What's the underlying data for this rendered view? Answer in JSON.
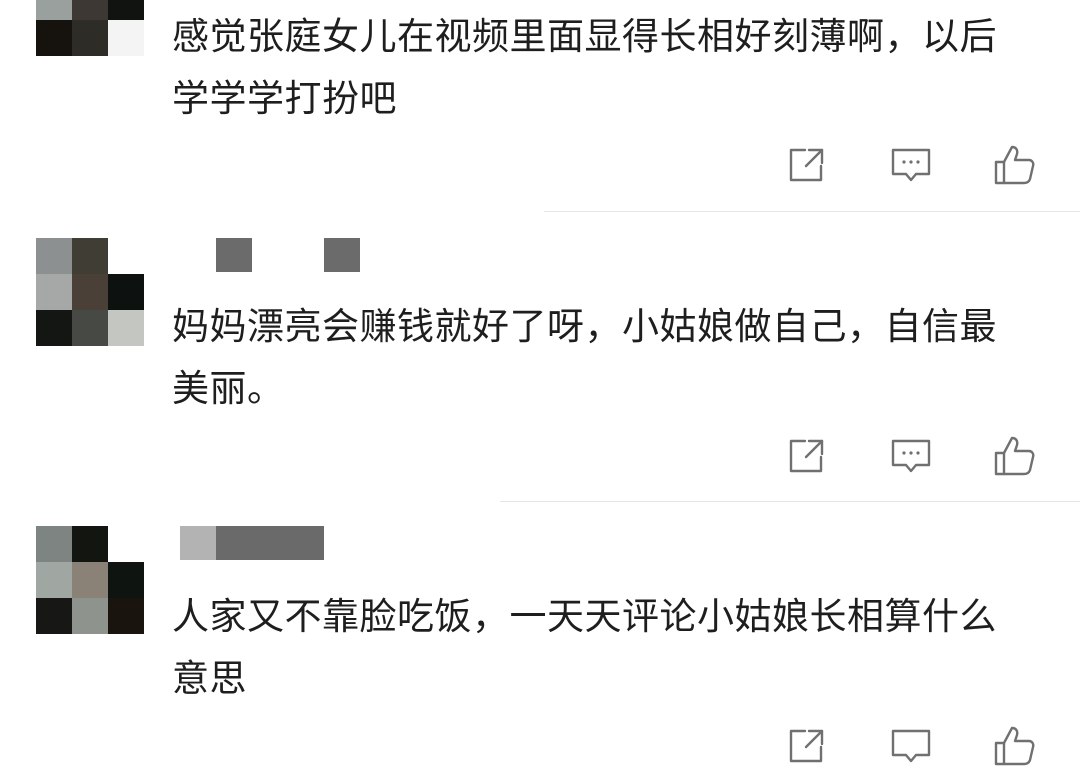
{
  "comments": [
    {
      "text": "感觉张庭女儿在视频里面显得长相好刻薄啊，以后学学学打扮吧",
      "avatar_colors": [
        "#8e9394",
        "#4d4137",
        "#1e1f1c",
        "#16130f",
        "#2d2c27",
        "#f4f4f4"
      ]
    },
    {
      "text": "妈妈漂亮会赚钱就好了呀，小姑娘做自己，自信最美丽。",
      "avatar_colors": [
        "#8c9091",
        "#3f3d34",
        "#ffffff",
        "#a5a8a7",
        "#4a4038",
        "#0d1110",
        "#131612",
        "#474a44",
        "#c4c6c1"
      ],
      "name_block_colors": [
        "#6b6b6b",
        "#6b6b6b"
      ]
    },
    {
      "text": "人家又不靠脸吃饭，一天天评论小姑娘长相算什么意思",
      "avatar_colors": [
        "#7e8481",
        "#121510",
        "#ffffff",
        "#a0a6a2",
        "#8a8276",
        "#0e1410",
        "#171815",
        "#8f938d",
        "#1a140e"
      ],
      "name_block_colors": [
        "#b3b3b3",
        "#6a6a6a"
      ]
    }
  ],
  "actions": {
    "share_icon": "share-icon",
    "reply_icon": "reply-icon",
    "like_icon": "thumbs-up-icon",
    "icon_color": "#707070"
  }
}
